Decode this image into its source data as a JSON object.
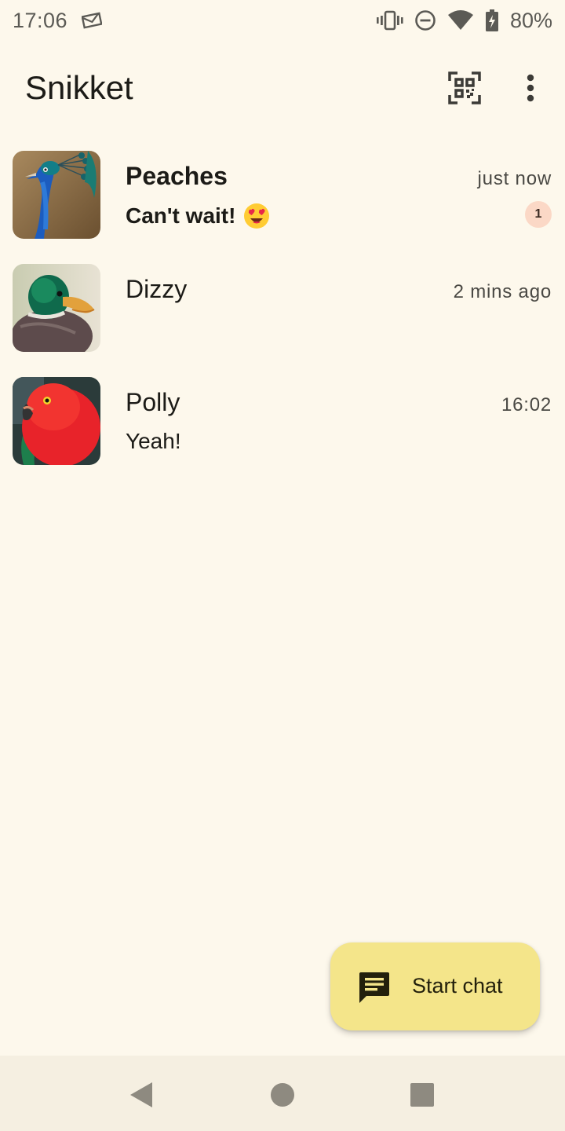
{
  "status_bar": {
    "time": "17:06",
    "battery_percent": "80%",
    "icons": [
      "email-icon",
      "vibrate-icon",
      "do-not-disturb-icon",
      "wifi-icon",
      "battery-charging-icon"
    ]
  },
  "app_bar": {
    "title": "Snikket",
    "actions": [
      "qr-code-icon",
      "more-vert-icon"
    ]
  },
  "chats": [
    {
      "name": "Peaches",
      "time": "just now",
      "preview": "Can't wait!",
      "preview_emoji": "heart-eyes-emoji",
      "unread_count": "1",
      "unread": true,
      "avatar": "peacock"
    },
    {
      "name": "Dizzy",
      "time": "2 mins ago",
      "preview": "",
      "unread": false,
      "avatar": "duck"
    },
    {
      "name": "Polly",
      "time": "16:02",
      "preview": "Yeah!",
      "unread": false,
      "avatar": "parrot"
    }
  ],
  "fab": {
    "label": "Start chat",
    "icon": "chat-bubble-icon",
    "color": "#f4e58a"
  },
  "nav_bar": {
    "buttons": [
      "back-icon",
      "home-icon",
      "recents-icon"
    ]
  },
  "colors": {
    "background": "#fdf8ec",
    "unread_badge": "#fbd8c6",
    "nav_bar": "#f5efe1"
  }
}
